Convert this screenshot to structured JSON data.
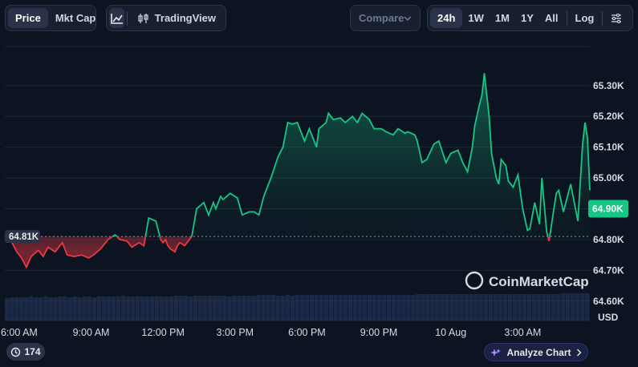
{
  "toolbar": {
    "type_tabs": [
      "Price",
      "Mkt Cap"
    ],
    "tradingview_label": "TradingView",
    "compare_label": "Compare",
    "ranges": [
      "24h",
      "1W",
      "1M",
      "1Y",
      "All"
    ],
    "log_label": "Log"
  },
  "footer": {
    "badge_count": "174",
    "analyze_label": "Analyze Chart"
  },
  "chart_data": {
    "type": "line",
    "watermark": "CoinMarketCap",
    "ylabel": "USD",
    "y_ticks": [
      "65.30K",
      "65.20K",
      "65.10K",
      "65.00K",
      "64.90K",
      "64.80K",
      "64.70K",
      "64.60K"
    ],
    "y_tick_values": [
      65300,
      65200,
      65100,
      65000,
      64900,
      64800,
      64700,
      64600
    ],
    "ylim": [
      64537,
      65427
    ],
    "x_ticks": [
      "6:00 AM",
      "9:00 AM",
      "12:00 PM",
      "3:00 PM",
      "6:00 PM",
      "9:00 PM",
      "10 Aug",
      "3:00 AM"
    ],
    "x_tick_hours": [
      6,
      9,
      12,
      15,
      18,
      21,
      24,
      27
    ],
    "xlim": [
      5.4,
      29.8
    ],
    "open_price": 64810,
    "open_label": "64.81K",
    "current_price": 64900,
    "current_label": "64.90K",
    "colors": {
      "up": "#16c784",
      "down": "#ea3943"
    },
    "series": [
      {
        "x": [
          5.4,
          5.7,
          5.9,
          6.1,
          6.3,
          6.5,
          6.8,
          7.0,
          7.2,
          7.5,
          7.8,
          8.0,
          8.3,
          8.6,
          8.9,
          9.1,
          9.4,
          9.7,
          10.0,
          10.2,
          10.5,
          10.7,
          11.0,
          11.2,
          11.4,
          11.7,
          11.9,
          12.0,
          12.1,
          12.2,
          12.3,
          12.5,
          12.6,
          12.7,
          12.9,
          13.2,
          13.4,
          13.7,
          13.9,
          14.1,
          14.2,
          14.4,
          14.5,
          14.8,
          15.1,
          15.3,
          15.6,
          15.8,
          16.0,
          16.2,
          16.5,
          16.8,
          17.0,
          17.2,
          17.4,
          17.6,
          17.9,
          18.1,
          18.4,
          18.5,
          18.8,
          18.9,
          19.1,
          19.4,
          19.6,
          19.9,
          20.1,
          20.3,
          20.6,
          20.8,
          21.1,
          21.3,
          21.6,
          21.8,
          22.1,
          22.2,
          22.5,
          22.6,
          22.8,
          23.0,
          23.3,
          23.5,
          23.8,
          24.0,
          24.3,
          24.5,
          24.7,
          24.9,
          25.0,
          25.2,
          25.3,
          25.4,
          25.6,
          25.7,
          25.9,
          26.0,
          26.1,
          26.3,
          26.4,
          26.6,
          26.8,
          27.0,
          27.2,
          27.3,
          27.5,
          27.7,
          27.8,
          28.0,
          28.1,
          28.3,
          28.4,
          28.5,
          28.7,
          28.8,
          29.0,
          29.2,
          29.3,
          29.5,
          29.6,
          29.7,
          29.8
        ],
        "y": [
          64810,
          64790,
          64760,
          64740,
          64710,
          64745,
          64765,
          64745,
          64775,
          64760,
          64790,
          64750,
          64745,
          64750,
          64740,
          64750,
          64770,
          64800,
          64815,
          64800,
          64795,
          64775,
          64790,
          64780,
          64870,
          64860,
          64800,
          64790,
          64800,
          64780,
          64770,
          64760,
          64780,
          64790,
          64780,
          64810,
          64900,
          64920,
          64880,
          64920,
          64900,
          64940,
          64930,
          64950,
          64935,
          64880,
          64890,
          64890,
          64880,
          64940,
          65000,
          65070,
          65100,
          65180,
          65175,
          65180,
          65120,
          65160,
          65100,
          65160,
          65180,
          65210,
          65190,
          65195,
          65180,
          65200,
          65180,
          65210,
          65190,
          65160,
          65160,
          65150,
          65140,
          65160,
          65145,
          65150,
          65140,
          65120,
          65050,
          65060,
          65110,
          65120,
          65050,
          65080,
          65090,
          65050,
          65020,
          65100,
          65170,
          65240,
          65270,
          65340,
          65200,
          65080,
          65000,
          64980,
          65060,
          65040,
          64990,
          64970,
          65010,
          64900,
          64830,
          64835,
          64920,
          64850,
          65000,
          64825,
          64795,
          64900,
          64950,
          64960,
          64890,
          64920,
          64980,
          64900,
          64860,
          65110,
          65180,
          65130,
          64960
        ],
        "volume": [
          28,
          29,
          29,
          29,
          29,
          30,
          29,
          29,
          30,
          29,
          29,
          30,
          30,
          29,
          30,
          29,
          30,
          30,
          29,
          30,
          30,
          30,
          30,
          30,
          31,
          30,
          30,
          30,
          30,
          30,
          30,
          30,
          30,
          30,
          30,
          31,
          31,
          31,
          30,
          31,
          31,
          31,
          31,
          31,
          31,
          31,
          30,
          31,
          31,
          31,
          31,
          31,
          32,
          32,
          32,
          32,
          31,
          31,
          32,
          31,
          32,
          32,
          32,
          32,
          32,
          32,
          32,
          32,
          32,
          32,
          32,
          32,
          32,
          32,
          32,
          32,
          32,
          32,
          32,
          32,
          32,
          32,
          32,
          32,
          32,
          33,
          33,
          33,
          33,
          33,
          33,
          33,
          33,
          33,
          33,
          33,
          33,
          33,
          33,
          33,
          33,
          33,
          33,
          33,
          33,
          33,
          33,
          33,
          33,
          33,
          33,
          33,
          33,
          33,
          33,
          34,
          34,
          34,
          34,
          34,
          34
        ]
      }
    ]
  }
}
